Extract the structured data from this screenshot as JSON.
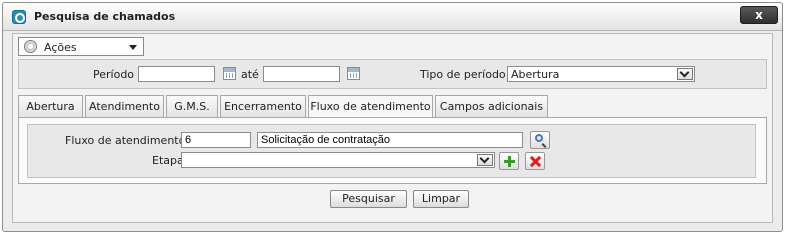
{
  "window": {
    "title": "Pesquisa de chamados",
    "close_label": "x"
  },
  "actions_menu": {
    "label": "Ações"
  },
  "period": {
    "label": "Período :",
    "start_value": "",
    "between_label": "até",
    "end_value": "",
    "type_label": "Tipo de período :",
    "type_selected": "Abertura"
  },
  "tabs": [
    {
      "label": "Abertura",
      "active": false
    },
    {
      "label": "Atendimento",
      "active": false
    },
    {
      "label": "G.M.S.",
      "active": false
    },
    {
      "label": "Encerramento",
      "active": false
    },
    {
      "label": "Fluxo de atendimento",
      "active": true
    },
    {
      "label": "Campos adicionais",
      "active": false
    }
  ],
  "fluxo": {
    "label": "Fluxo de atendimento :",
    "code_value": "6",
    "description_value": "Solicitação de contratação",
    "etapa_label": "Etapa :",
    "etapa_selected": ""
  },
  "buttons": {
    "search_label": "Pesquisar",
    "clear_label": "Limpar"
  },
  "icons": {
    "search": "magnifier-icon",
    "add": "add-green-icon",
    "remove": "delete-red-icon",
    "calendar": "calendar-icon"
  }
}
